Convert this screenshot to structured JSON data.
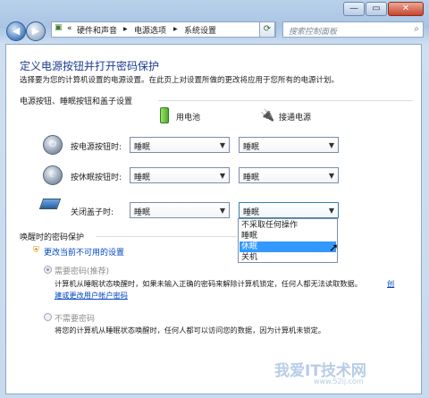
{
  "window": {
    "minimize": "—",
    "maximize": "▭",
    "close": "✕"
  },
  "address": {
    "chevron": "«",
    "crumbs": [
      "硬件和声音",
      "电源选项",
      "系统设置"
    ],
    "arrow_sep": "▶",
    "search_placeholder": "搜索控制面板"
  },
  "page": {
    "title": "定义电源按钮并打开密码保护",
    "description": "选择要为您的计算机设置的电源设置。在此页上对设置所做的更改将应用于您所有的电源计划。",
    "section1": "电源按钮、睡眠按钮和盖子设置",
    "col_battery": "用电池",
    "col_plugged": "接通电源",
    "rows": [
      {
        "label": "按电源按钮时:",
        "battery": "睡眠",
        "plugged": "睡眠"
      },
      {
        "label": "按休眠按钮时:",
        "battery": "睡眠",
        "plugged": "睡眠"
      },
      {
        "label": "关闭盖子时:",
        "battery": "睡眠",
        "plugged": "睡眠"
      }
    ],
    "dropdown_options": [
      "不采取任何操作",
      "睡眠",
      "休眠",
      "关机"
    ],
    "dropdown_selected": "休眠",
    "section2": "唤醒时的密码保护",
    "change_link": "更改当前不可用的设置",
    "opt1_label": "需要密码(推荐)",
    "opt1_desc1": "计算机从睡眠状态唤醒时，如果未输入正确的密码来解除计算机锁定，任何人都无法读取数据。",
    "opt1_link_a": "创",
    "opt1_link_b": "建或更改用户帐户密码",
    "opt2_label": "不需要密码",
    "opt2_desc": "将您的计算机从睡眠状态唤醒时，任何人都可以访问您的数据，因为计算机未锁定。"
  },
  "watermark": {
    "text": "我爱IT技术网",
    "url": "www.52ij.com"
  }
}
